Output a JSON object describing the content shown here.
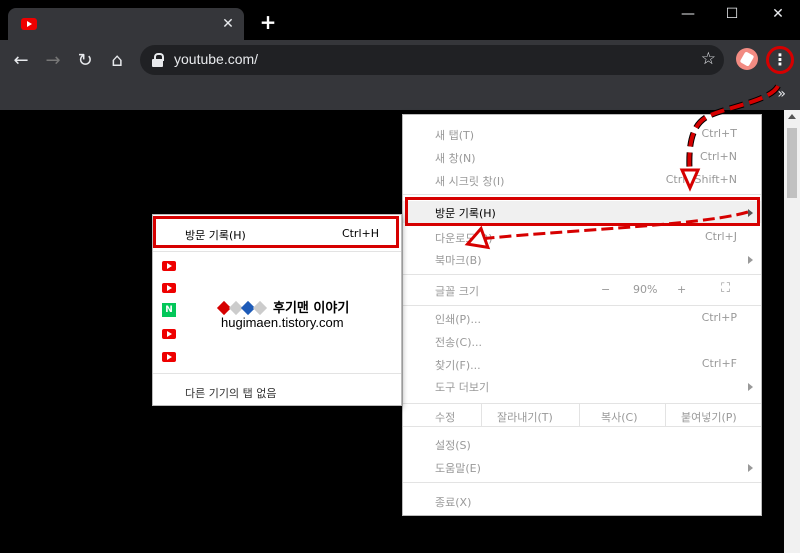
{
  "browser": {
    "tab_close": "✕",
    "new_tab": "+",
    "url": "youtube.com/",
    "minimize": "—",
    "maximize": "☐",
    "close": "✕",
    "bookmarks_more": "»"
  },
  "menu": {
    "new_tab": {
      "label": "새 탭(T)",
      "shortcut": "Ctrl+T"
    },
    "new_window": {
      "label": "새 창(N)",
      "shortcut": "Ctrl+N"
    },
    "incognito": {
      "label": "새 시크릿 창(I)",
      "shortcut": "Ctrl+Shift+N"
    },
    "history": {
      "label": "방문 기록(H)"
    },
    "downloads": {
      "label": "다운로드(D)",
      "shortcut": "Ctrl+J"
    },
    "bookmarks": {
      "label": "북마크(B)"
    },
    "zoom": {
      "label": "글꼴 크기",
      "minus": "−",
      "value": "90%",
      "plus": "+"
    },
    "print": {
      "label": "인쇄(P)...",
      "shortcut": "Ctrl+P"
    },
    "cast": {
      "label": "전송(C)..."
    },
    "find": {
      "label": "찾기(F)...",
      "shortcut": "Ctrl+F"
    },
    "more_tools": {
      "label": "도구 더보기"
    },
    "edit": {
      "label": "수정",
      "cut": "잘라내기(T)",
      "copy": "복사(C)",
      "paste": "붙여넣기(P)"
    },
    "settings": {
      "label": "설정(S)"
    },
    "help": {
      "label": "도움말(E)"
    },
    "exit": {
      "label": "종료(X)"
    }
  },
  "history_submenu": {
    "label": "방문 기록(H)",
    "shortcut": "Ctrl+H",
    "items": [
      "youtube",
      "youtube",
      "naver",
      "youtube",
      "youtube"
    ],
    "no_tabs": "다른 기기의 탭 없음"
  },
  "watermark": {
    "line1": "후기맨 이야기",
    "line2": "hugimaen.tistory.com"
  },
  "colors": {
    "highlight_red": "#d60000",
    "youtube_red": "#ee0000",
    "naver_green": "#03c75a"
  }
}
